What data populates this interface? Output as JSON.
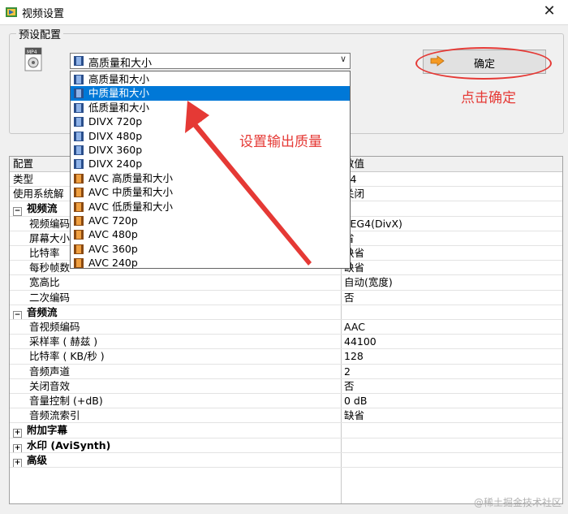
{
  "window": {
    "title": "视频设置",
    "close_glyph": "✕"
  },
  "preset": {
    "group_label": "预设配置",
    "combo_value": "高质量和大小",
    "combo_arrow": "∨",
    "ok_label": "确定"
  },
  "annotations": {
    "click_ok": "点击确定",
    "set_quality": "设置输出质量",
    "color": "#e53935"
  },
  "dropdown": {
    "selected_index": 1,
    "options": [
      "高质量和大小",
      "中质量和大小",
      "低质量和大小",
      "DIVX 720p",
      "DIVX 480p",
      "DIVX 360p",
      "DIVX 240p",
      "AVC 高质量和大小",
      "AVC 中质量和大小",
      "AVC 低质量和大小",
      "AVC 720p",
      "AVC 480p",
      "AVC 360p",
      "AVC 240p"
    ]
  },
  "grid": {
    "header": {
      "col1": "配置",
      "col2": "数值"
    },
    "rows": [
      {
        "c1": "类型",
        "c2": "P4",
        "indent": 0
      },
      {
        "c1": "使用系统解",
        "c2": "关闭",
        "indent": 0
      },
      {
        "c1": "视频流",
        "c2": "",
        "section": true,
        "expand": "−"
      },
      {
        "c1": "视频编码",
        "c2": "PEG4(DivX)",
        "indent": 1
      },
      {
        "c1": "屏幕大小",
        "c2": "省",
        "indent": 1
      },
      {
        "c1": "比特率",
        "c2": "缺省",
        "indent": 1
      },
      {
        "c1": "每秒帧数",
        "c2": "缺省",
        "indent": 1
      },
      {
        "c1": "宽高比",
        "c2": "自动(宽度)",
        "indent": 1
      },
      {
        "c1": "二次编码",
        "c2": "否",
        "indent": 1
      },
      {
        "c1": "音频流",
        "c2": "",
        "section": true,
        "expand": "−"
      },
      {
        "c1": "音视频编码",
        "c2": "AAC",
        "indent": 1
      },
      {
        "c1": "采样率 ( 赫兹 )",
        "c2": "44100",
        "indent": 1
      },
      {
        "c1": "比特率 ( KB/秒 )",
        "c2": "128",
        "indent": 1
      },
      {
        "c1": "音频声道",
        "c2": "2",
        "indent": 1
      },
      {
        "c1": "关闭音效",
        "c2": "否",
        "indent": 1
      },
      {
        "c1": "音量控制 (+dB)",
        "c2": "0 dB",
        "indent": 1
      },
      {
        "c1": "音频流索引",
        "c2": "缺省",
        "indent": 1
      },
      {
        "c1": "附加字幕",
        "c2": "",
        "section": true,
        "expand": "+"
      },
      {
        "c1": "水印 (AviSynth)",
        "c2": "",
        "section": true,
        "expand": "+"
      },
      {
        "c1": "高级",
        "c2": "",
        "section": true,
        "expand": "+"
      }
    ]
  },
  "watermark": "@稀土掘金技术社区"
}
